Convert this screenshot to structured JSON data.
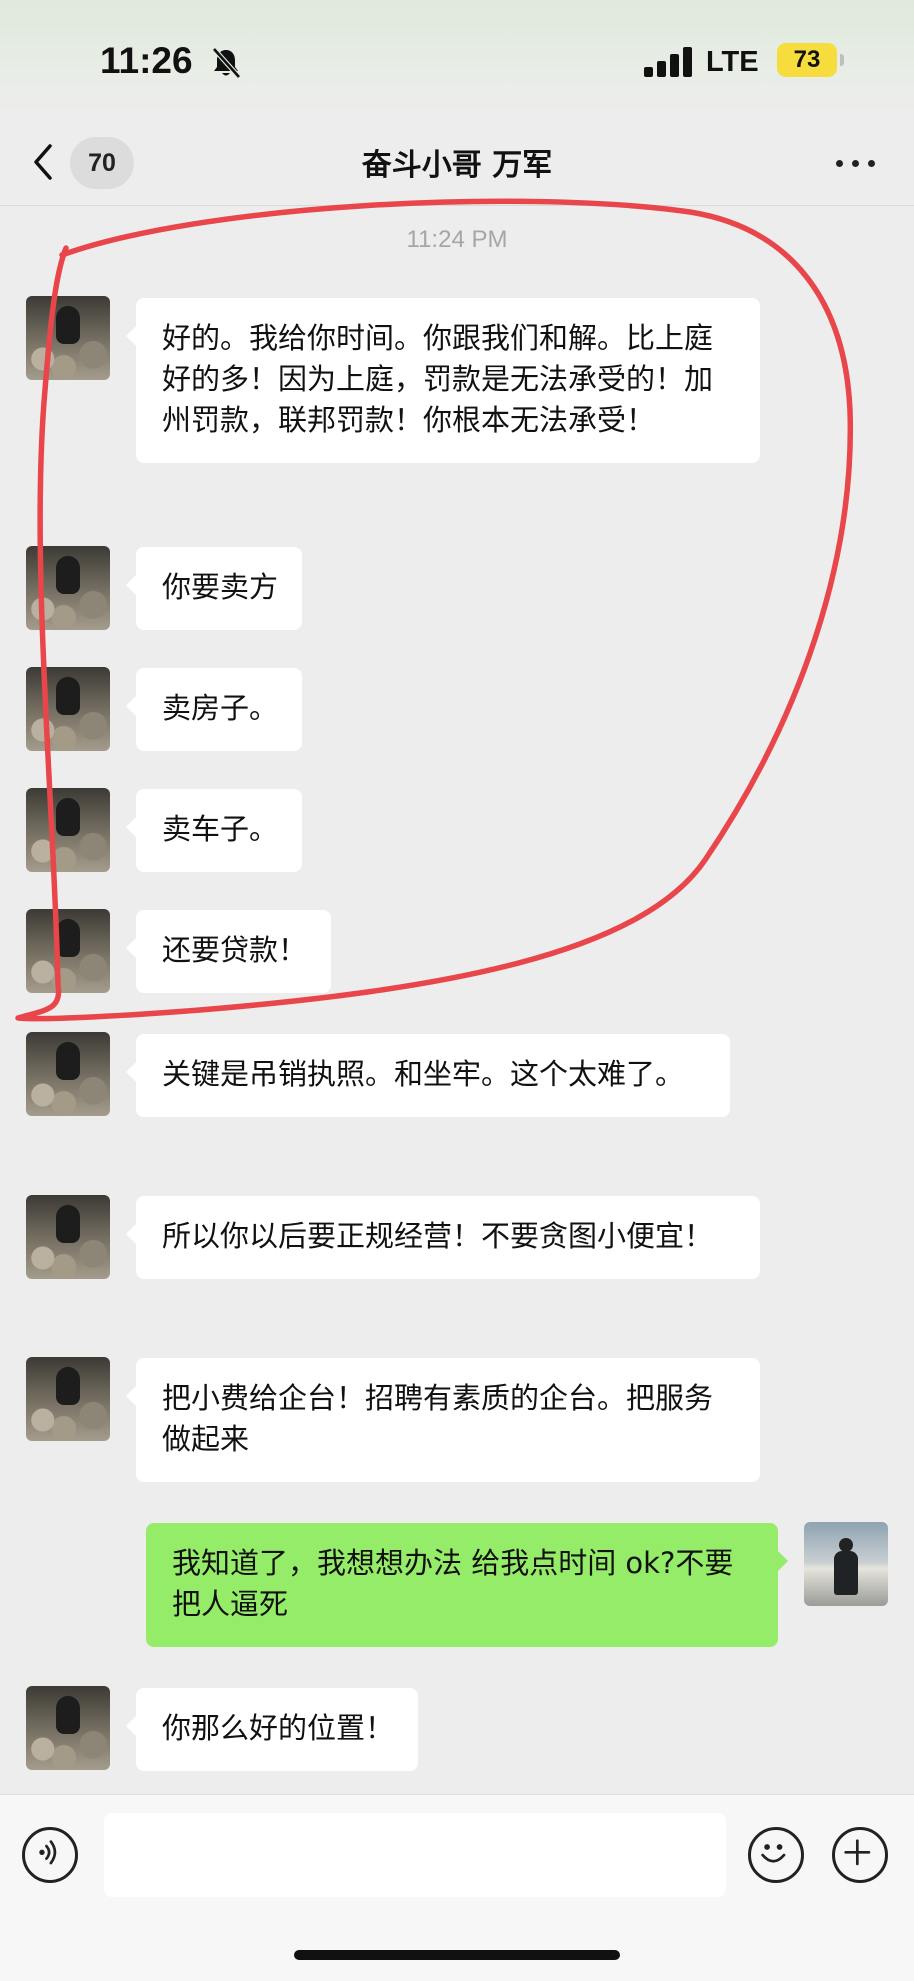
{
  "status_bar": {
    "time": "11:26",
    "network": "LTE",
    "battery": "73",
    "battery_color": "#f6dc3c"
  },
  "nav": {
    "unread_count": "70",
    "title": "奋斗小哥 万军",
    "back_icon": "chevron-left-icon",
    "more_icon": "more-horizontal-icon"
  },
  "conversation": {
    "timestamp": "11:24 PM",
    "messages": [
      {
        "sender": "other",
        "text": "好的。我给你时间。你跟我们和解。比上庭好的多！因为上庭，罚款是无法承受的！加州罚款，联邦罚款！你根本无法承受！"
      },
      {
        "sender": "other",
        "text": "你要卖方"
      },
      {
        "sender": "other",
        "text": "卖房子。"
      },
      {
        "sender": "other",
        "text": "卖车子。"
      },
      {
        "sender": "other",
        "text": "还要贷款！"
      },
      {
        "sender": "other",
        "text": "关键是吊销执照。和坐牢。这个太难了。"
      },
      {
        "sender": "other",
        "text": "所以你以后要正规经营！不要贪图小便宜！"
      },
      {
        "sender": "other",
        "text": "把小费给企台！招聘有素质的企台。把服务做起来"
      },
      {
        "sender": "self",
        "text": "我知道了，我想想办法 给我点时间 ok?不要把人逼死"
      },
      {
        "sender": "other",
        "text": "你那么好的位置！"
      }
    ]
  },
  "input_bar": {
    "voice_icon": "voice-icon",
    "emoji_icon": "emoji-icon",
    "add_icon": "plus-circle-icon"
  },
  "colors": {
    "bubble_self": "#95ec69",
    "bubble_other": "#ffffff",
    "chat_background": "#ededed",
    "annotation": "#e8464b"
  }
}
